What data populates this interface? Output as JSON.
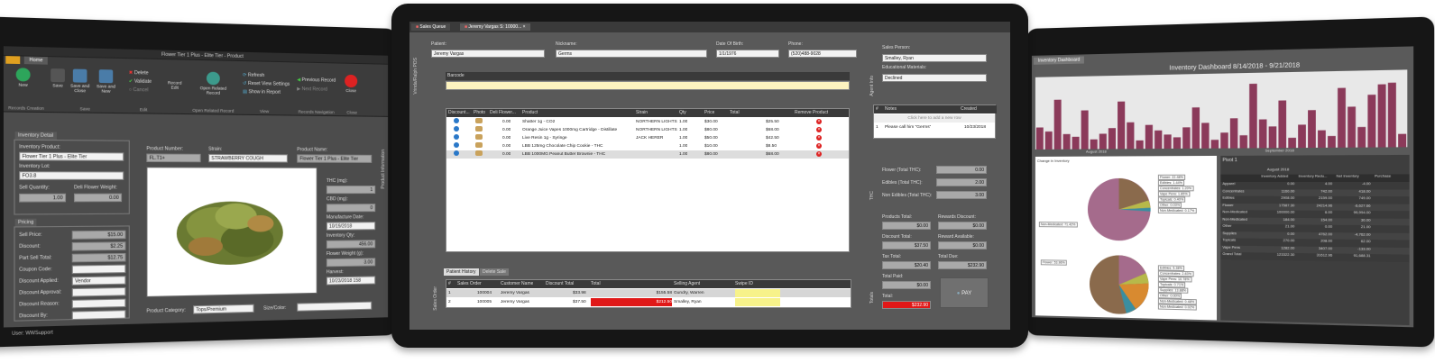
{
  "left_tablet": {
    "window_title": "Flower Tier 1 Plus - Elite Tier - Product",
    "tab_home": "Home",
    "ribbon": {
      "new": "New",
      "save": "Save",
      "save_close": "Save and Close",
      "save_new": "Save and New",
      "delete": "Delete",
      "validate": "Validate",
      "cancel": "Cancel",
      "record_edit": "Record Edit",
      "open_related": "Open Related Record",
      "refresh": "Refresh",
      "reset_view": "Reset View Settings",
      "show_in_report": "Show in Report",
      "prev_record": "Previous Record",
      "next_record": "Next Record",
      "close": "Close",
      "grp_records_creation": "Records Creation",
      "grp_save": "Save",
      "grp_edit": "Edit",
      "grp_open_related": "Open Related Record",
      "grp_view": "View",
      "grp_records_nav": "Records Navigation",
      "grp_close": "Close"
    },
    "inventory_detail": {
      "tab": "Inventory Detail",
      "inventory_product_label": "Inventory Product:",
      "inventory_product_value": "Flower Tier 1 Plus - Elite Tier",
      "inventory_lot_label": "Inventory Lot:",
      "inventory_lot_value": "FO3.8",
      "sell_qty_label": "Sell Quantity:",
      "sell_qty_value": "1.00",
      "deli_weight_label": "Deli Flower Weight:",
      "deli_weight_value": "0.00"
    },
    "pricing": {
      "tab": "Pricing",
      "sell_price_label": "Sell Price:",
      "sell_price_value": "$15.00",
      "discount_label": "Discount:",
      "discount_value": "$2.25",
      "part_total_label": "Part Sell Total:",
      "part_total_value": "$12.75",
      "coupon_label": "Coupon Code:",
      "discount_applied_label": "Discount Applied:",
      "discount_applied_value": "Vendor",
      "discount_approval_label": "Discount Approval:",
      "discount_reason_label": "Discount Reason:",
      "discount_by_label": "Discount By:"
    },
    "product": {
      "product_number_label": "Product Number:",
      "product_number_value": "FL.T1+",
      "strain_label": "Strain:",
      "strain_value": "STRAWBERRY COUGH",
      "product_name_label": "Product Name:",
      "product_name_value": "Flower Tier 1 Plus - Elite Tier",
      "thc_label": "THC (mg):",
      "thc_value": "1",
      "cbd_label": "CBD (mg):",
      "cbd_value": "0",
      "manufacture_label": "Manufacture Date:",
      "manufacture_value": "10/19/2018",
      "inventory_qty_label": "Inventory Qty:",
      "inventory_qty_value": "456.00",
      "flower_weight_label": "Flower Weight (g):",
      "flower_weight_value": "3.00",
      "harvest_label": "Harvest:",
      "harvest_value": "10/23/2018 158",
      "category_label": "Product Category:",
      "category_value": "Tops/Premium",
      "size_color_label": "Size/Color:",
      "side_tab": "Product Information"
    },
    "status_user": "User: WWSupport"
  },
  "center_tablet": {
    "tabs": [
      "Sales Queue",
      "Jeremy Vargas S: 10000..."
    ],
    "side_tab_left": "Vrinda/Ralph POS",
    "patient_label": "Patient:",
    "patient_value": "Jeremy Vargas",
    "nickname_label": "Nickname:",
    "nickname_value": "Germs",
    "dob_label": "Date Of Birth:",
    "dob_value": "1/1/1976",
    "phone_label": "Phone:",
    "phone_value": "(520)488-9028",
    "barcode_label": "Barcode",
    "items_headers": [
      "Discount...",
      "Photo",
      "Deli Flower...",
      "Product",
      "Strain",
      "Qty",
      "Price",
      "Total",
      "Remove Product"
    ],
    "items": [
      {
        "deli": "0.00",
        "product": "Shatter 1g - CO2",
        "strain": "NORTHERN LIGHTS",
        "qty": "1.00",
        "price": "$30.00",
        "total": "$25.50"
      },
      {
        "deli": "0.00",
        "product": "Orange Juice Vapes 1000mg Cartridge - Distillate",
        "strain": "NORTHERN LIGHTS",
        "qty": "1.00",
        "price": "$80.00",
        "total": "$68.00"
      },
      {
        "deli": "0.00",
        "product": "Live Resin 1g - Syringe",
        "strain": "JACK HERER",
        "qty": "1.00",
        "price": "$50.00",
        "total": "$42.50"
      },
      {
        "deli": "0.00",
        "product": "LBB 125mg Chocolate Chip Cookie - THC",
        "strain": "",
        "qty": "1.00",
        "price": "$10.00",
        "total": "$8.50"
      },
      {
        "deli": "0.00",
        "product": "LBB 1000MG Peanut Butter Brownie - THC",
        "strain": "",
        "qty": "1.00",
        "price": "$80.00",
        "total": "$68.00"
      }
    ],
    "history_tabs": [
      "Patient History",
      "Delete Sale"
    ],
    "history_side": "Sales Order",
    "history_headers": [
      "#",
      "Sales Order",
      "Customer Name",
      "Discount Total",
      "Total",
      "Selling Agent",
      "Swipe ID"
    ],
    "history_rows": [
      {
        "n": "1",
        "order": "100004",
        "name": "Jeremy Vargas",
        "disc": "$33.98",
        "total": "$155.58",
        "agent": "Gundry, Warren"
      },
      {
        "n": "2",
        "order": "100005",
        "name": "Jeremy Vargas",
        "disc": "$37.50",
        "total": "$212.50",
        "agent": "Smalley, Ryan"
      }
    ],
    "agent_side": "Agent Info",
    "sales_person_label": "Sales Person:",
    "sales_person_value": "Smalley, Ryan",
    "edu_label": "Educational Materials:",
    "edu_value": "Declined",
    "notes_headers": [
      "#",
      "Notes",
      "Created"
    ],
    "notes_add": "Click here to add a new row",
    "notes_row": {
      "n": "1",
      "note": "Please call him \"Germs\"",
      "created": "10/23/2018"
    },
    "thc_side": "THC",
    "flower_thc_label": "Flower (Total THC):",
    "flower_thc_value": "0.00",
    "edibles_thc_label": "Edibles (Total THC):",
    "edibles_thc_value": "2.00",
    "non_edibles_label": "Non Edibles (Total THC):",
    "non_edibles_value": "3.00",
    "totals_side": "Totals",
    "products_total_label": "Products Total:",
    "products_total_value": "$0.00",
    "rewards_discount_label": "Rewards Discount:",
    "rewards_discount_value": "$0.00",
    "discount_total_label": "Discount Total:",
    "discount_total_value": "$37.50",
    "reward_available_label": "Reward Available:",
    "reward_available_value": "$0.00",
    "tax_total_label": "Tax Total:",
    "tax_total_value": "$20.40",
    "total_due_label": "Total Due:",
    "total_due_value": "$232.90",
    "total_paid_label": "Total Paid:",
    "total_paid_value": "$0.00",
    "total_label": "Total:",
    "total_value": "$232.90",
    "pay_label": "PAY"
  },
  "right_tablet": {
    "tab": "Inventory Dashboard",
    "title": "Inventory Dashboard  8/14/2018 - 9/21/2018",
    "axis_aug": "August 2018",
    "axis_sep": "September 2018",
    "pie_title": "Change in Inventory",
    "pivot_title": "Pivot 1",
    "pivot_month": "August 2018",
    "pivot_headers": [
      "",
      "Inventory Added",
      "Inventory Redu...",
      "Net Inventory",
      "Purchase"
    ],
    "pivot_rows": [
      {
        "label": "Apparel",
        "a": "0.00",
        "b": "4.00",
        "c": "-4.00"
      },
      {
        "label": "Concentrates",
        "a": "1160.00",
        "b": "742.00",
        "c": "418.00"
      },
      {
        "label": "Edibles",
        "a": "2908.00",
        "b": "2159.00",
        "c": "749.00"
      },
      {
        "label": "Flower",
        "a": "17587.30",
        "b": "24214.96",
        "c": "-6,627.66"
      },
      {
        "label": "Non-Medicated",
        "a": "100000.00",
        "b": "6.00",
        "c": "99,994.00"
      },
      {
        "label": "Non-Medicated",
        "a": "184.00",
        "b": "154.00",
        "c": "30.00"
      },
      {
        "label": "Other",
        "a": "21.00",
        "b": "0.00",
        "c": "21.00"
      },
      {
        "label": "Supplies",
        "a": "0.00",
        "b": "4762.00",
        "c": "-4,762.00"
      },
      {
        "label": "Topicals",
        "a": "270.00",
        "b": "208.00",
        "c": "62.00"
      },
      {
        "label": "Vape Pens",
        "a": "1282.00",
        "b": "3407.00",
        "c": "-133.00"
      },
      {
        "label": "Grand Total",
        "a": "123322.30",
        "b": "31612.96",
        "c": "91,688.31"
      }
    ],
    "pie1_labels": [
      "Flower: 22.48%",
      "Edibles: 1.44%",
      "Concentrates: 1.20%",
      "Vape Pens: 1.85%",
      "Topicals: 0.40%",
      "Other: 0.03%",
      "Non-Medicated: 0.17%",
      "Non-Medicated: 71.42%"
    ],
    "pie2_labels": [
      "Flower: 53.96%",
      "Edibles: 5.38%",
      "Concentrates: 2.83%",
      "Vape Pens: 10.78%",
      "Topicals: 0.71%",
      "Supplies: 13.88%",
      "Other: 0.00%",
      "Non-Medicated: 0.48%",
      "Non-Medicated: 0.02%"
    ],
    "bars": [
      0.32,
      0.26,
      0.72,
      0.22,
      0.18,
      0.56,
      0.14,
      0.22,
      0.3,
      0.68,
      0.38,
      0.12,
      0.34,
      0.26,
      0.2,
      0.16,
      0.3,
      0.58,
      0.36,
      0.12,
      0.22,
      0.42,
      0.18,
      0.9,
      0.4,
      0.3,
      0.66,
      0.14,
      0.32,
      0.52,
      0.24,
      0.16,
      0.82,
      0.56,
      0.28,
      0.72,
      0.86,
      0.88,
      0.18
    ],
    "colors": {
      "bar": "#8b3a5a",
      "pie_main": "#a56b8c",
      "pie_flower": "#8a6a4c",
      "pie_edibles": "#b7b94a",
      "pie_orange": "#d88a30",
      "pie_teal": "#3a8ea0"
    }
  }
}
